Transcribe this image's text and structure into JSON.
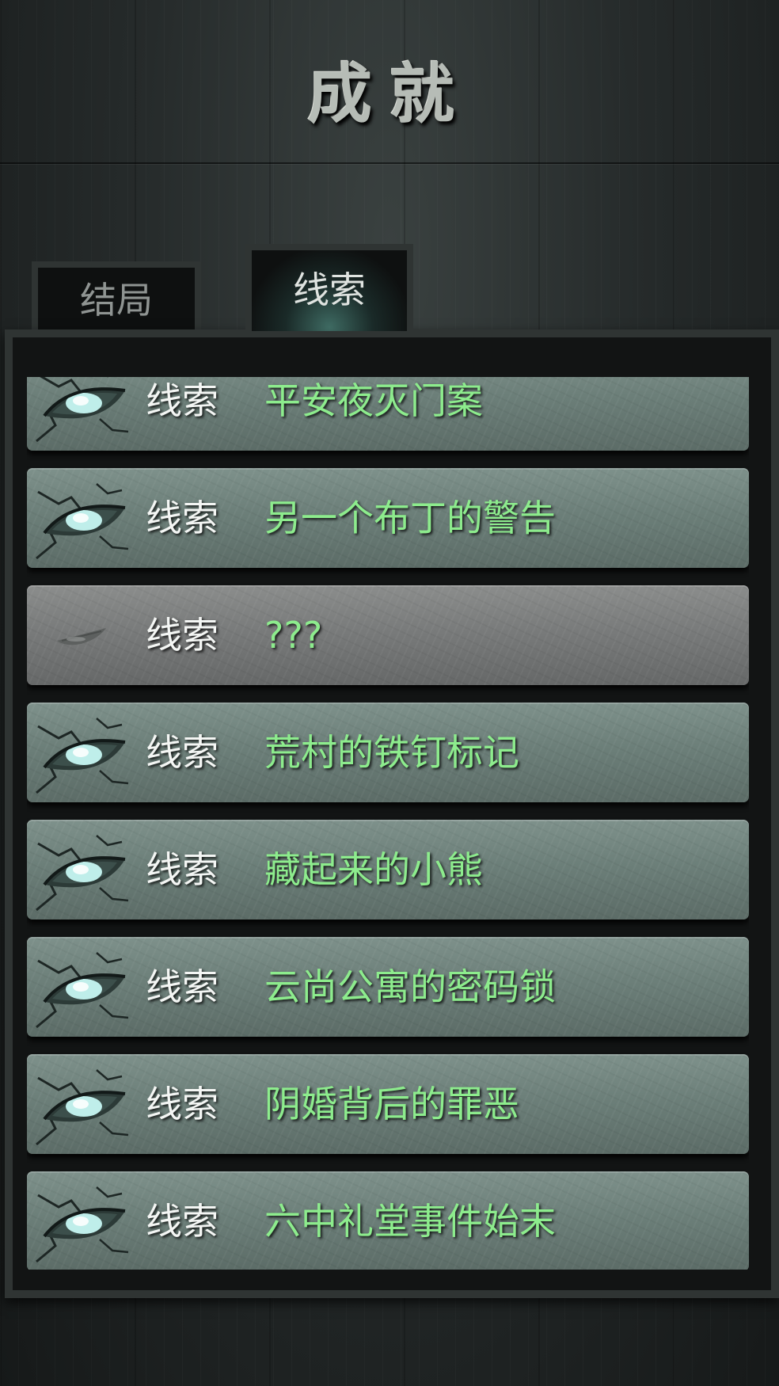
{
  "title": "成就",
  "tabs": [
    {
      "label": "结局",
      "active": false
    },
    {
      "label": "线索",
      "active": true
    }
  ],
  "items": [
    {
      "kind": "线索",
      "name": "平安夜灭门案",
      "unlocked": true
    },
    {
      "kind": "线索",
      "name": "另一个布丁的警告",
      "unlocked": true
    },
    {
      "kind": "线索",
      "name": "???",
      "unlocked": false
    },
    {
      "kind": "线索",
      "name": "荒村的铁钉标记",
      "unlocked": true
    },
    {
      "kind": "线索",
      "name": "藏起来的小熊",
      "unlocked": true
    },
    {
      "kind": "线索",
      "name": "云尚公寓的密码锁",
      "unlocked": true
    },
    {
      "kind": "线索",
      "name": "阴婚背后的罪恶",
      "unlocked": true
    },
    {
      "kind": "线索",
      "name": "六中礼堂事件始末",
      "unlocked": true
    }
  ],
  "colors": {
    "item_name": "#8dec8d",
    "item_kind": "#f4f6f4",
    "unlocked_card": "#6c7f79",
    "locked_card": "#777979",
    "frame": "#2f3433"
  },
  "icons": {
    "unlocked": "cracked-eye-icon",
    "locked": "closed-eye-icon"
  }
}
